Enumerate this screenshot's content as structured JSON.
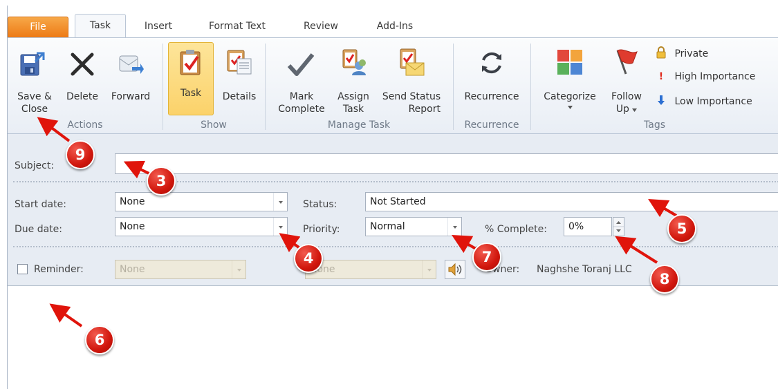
{
  "ribbon": {
    "tabs": [
      {
        "label": "File",
        "state": "file"
      },
      {
        "label": "Task",
        "state": "active"
      },
      {
        "label": "Insert"
      },
      {
        "label": "Format Text"
      },
      {
        "label": "Review"
      },
      {
        "label": "Add-Ins"
      }
    ],
    "groups": {
      "actions": {
        "label": "Actions",
        "save_close_line1": "Save &",
        "save_close_line2": "Close",
        "delete": "Delete",
        "forward": "Forward"
      },
      "show": {
        "label": "Show",
        "task": "Task",
        "details": "Details"
      },
      "manage_task": {
        "label": "Manage Task",
        "mark_complete_line1": "Mark",
        "mark_complete_line2": "Complete",
        "assign_task_line1": "Assign",
        "assign_task_line2": "Task",
        "send_status_line1": "Send Status",
        "send_status_line2": "Report"
      },
      "recurrence": {
        "label": "Recurrence",
        "recurrence": "Recurrence"
      },
      "tags": {
        "label": "Tags",
        "categorize": "Categorize",
        "follow_up_line1": "Follow",
        "follow_up_line2": "Up",
        "private": "Private",
        "high_importance": "High Importance",
        "low_importance": "Low Importance"
      }
    }
  },
  "form": {
    "subject_label": "Subject:",
    "subject_value": "",
    "start_date_label": "Start date:",
    "start_date_value": "None",
    "due_date_label": "Due date:",
    "due_date_value": "None",
    "status_label": "Status:",
    "status_value": "Not Started",
    "priority_label": "Priority:",
    "priority_value": "Normal",
    "percent_label": "% Complete:",
    "percent_value": "0%",
    "reminder_label": "Reminder:",
    "reminder_checked": false,
    "reminder_date_value": "None",
    "reminder_time_value": "None",
    "owner_label": "Owner:",
    "owner_value": "Naghshe Toranj LLC"
  },
  "annotations": [
    "9",
    "3",
    "4",
    "5",
    "6",
    "7",
    "8"
  ],
  "colors": {
    "file_tab": "#ed7a15",
    "active_button": "#fbd26a",
    "badge_red": "#d1170d",
    "arrow_red": "#e0140b"
  }
}
